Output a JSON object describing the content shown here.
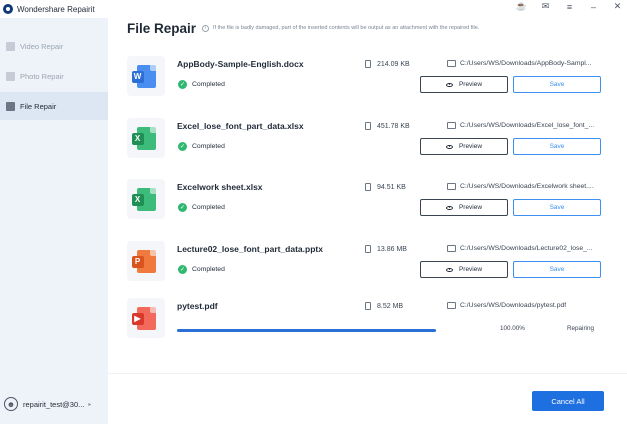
{
  "app": {
    "title": "Wondershare Repairit"
  },
  "window_controls": [
    {
      "icon": "headset-icon",
      "glyph": "☕"
    },
    {
      "icon": "mail-icon",
      "glyph": "✉"
    },
    {
      "icon": "menu-icon",
      "glyph": "≡"
    },
    {
      "icon": "minimize-icon",
      "glyph": "–"
    },
    {
      "icon": "close-icon",
      "glyph": "✕"
    }
  ],
  "sidebar": {
    "items": [
      {
        "label": "Video Repair",
        "icon": "video-icon",
        "active": false
      },
      {
        "label": "Photo Repair",
        "icon": "photo-icon",
        "active": false
      },
      {
        "label": "File Repair",
        "icon": "file-icon",
        "active": true
      }
    ],
    "user": {
      "name": "repairit_test@30...",
      "icon": "user-avatar-icon"
    }
  },
  "header": {
    "title": "File Repair",
    "note": "If the file is badly damaged, part of the inserted contents will be output as an attachment with the repaired file."
  },
  "files": [
    {
      "name": "AppBody-Sample-English.docx",
      "type": "word",
      "letter": "W",
      "size": "214.09  KB",
      "path": "C:/Users/WS/Downloads/AppBody-Sampl...",
      "status": "Completed"
    },
    {
      "name": "Excel_lose_font_part_data.xlsx",
      "type": "excel",
      "letter": "X",
      "size": "451.78  KB",
      "path": "C:/Users/WS/Downloads/Excel_lose_font_...",
      "status": "Completed"
    },
    {
      "name": "Excelwork sheet.xlsx",
      "type": "excel",
      "letter": "X",
      "size": "94.51  KB",
      "path": "C:/Users/WS/Downloads/Excelwork sheet....",
      "status": "Completed"
    },
    {
      "name": "Lecture02_lose_font_part_data.pptx",
      "type": "ppt",
      "letter": "P",
      "size": "13.86  MB",
      "path": "C:/Users/WS/Downloads/Lecture02_lose_...",
      "status": "Completed"
    }
  ],
  "processing_file": {
    "name": "pytest.pdf",
    "type": "pdf",
    "letter": "▶",
    "size": "8.52  MB",
    "path": "C:/Users/WS/Downloads/pytest.pdf",
    "progress_percent": 100,
    "progress_label": "100.00%",
    "status": "Repairing"
  },
  "buttons": {
    "preview": "Preview",
    "save": "Save",
    "cancel_all": "Cancel All"
  },
  "colors": {
    "accent": "#1e6fe0",
    "sidebar_bg": "#eef3f9",
    "success": "#2fb86f"
  }
}
